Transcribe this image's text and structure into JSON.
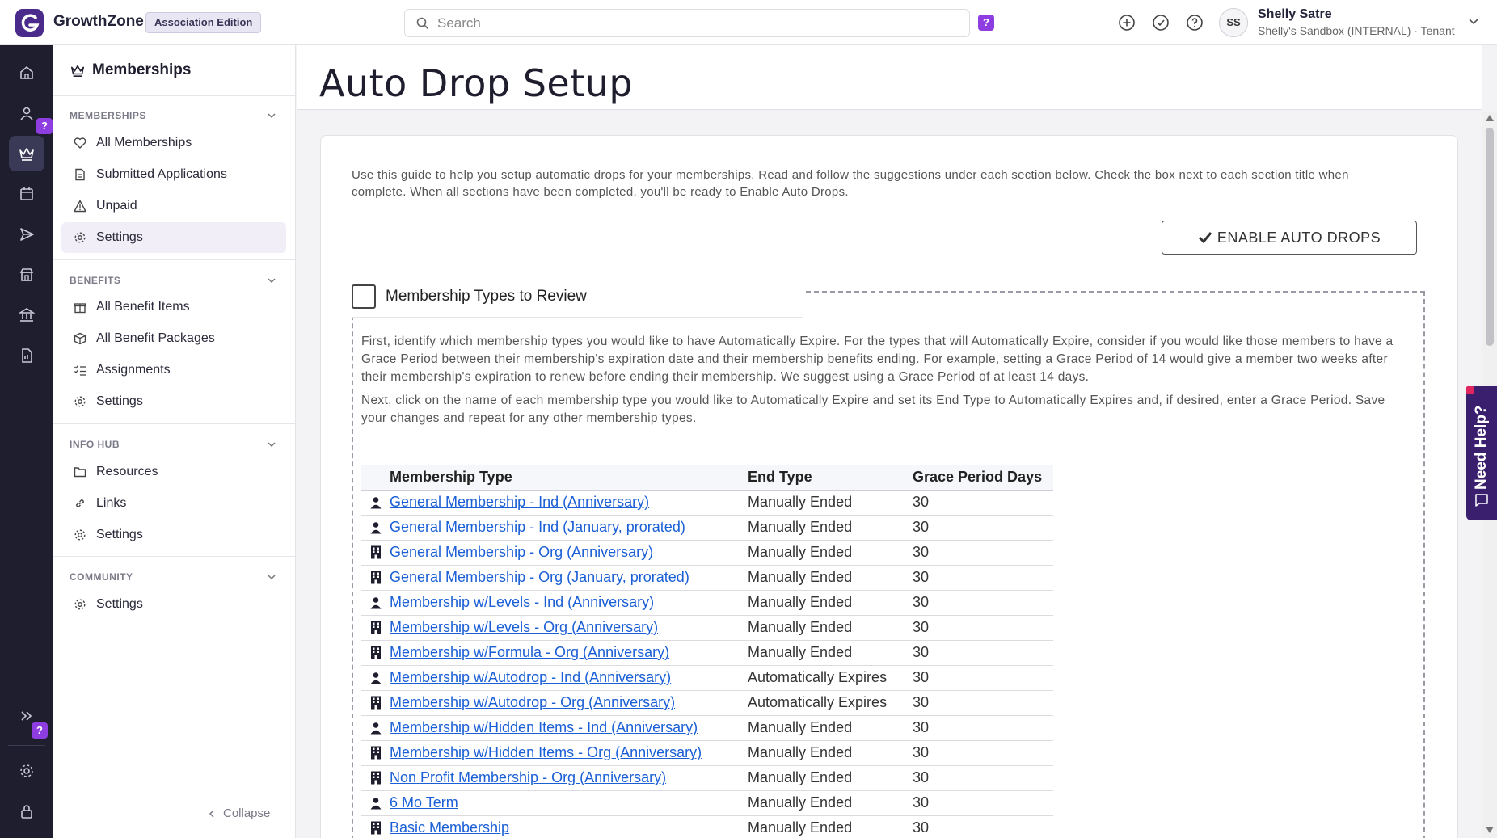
{
  "app": {
    "name": "GrowthZone",
    "edition": "Association Edition"
  },
  "search": {
    "placeholder": "Search"
  },
  "user": {
    "initials": "SS",
    "name": "Shelly Satre",
    "org": "Shelly's Sandbox (INTERNAL) · Tenant"
  },
  "sidebar": {
    "title": "Memberships",
    "sections": [
      {
        "label": "MEMBERSHIPS",
        "items": [
          {
            "label": "All Memberships",
            "icon": "heart-icon"
          },
          {
            "label": "Submitted Applications",
            "icon": "document-icon"
          },
          {
            "label": "Unpaid",
            "icon": "warning-icon"
          },
          {
            "label": "Settings",
            "icon": "gear-icon",
            "active": true
          }
        ]
      },
      {
        "label": "BENEFITS",
        "items": [
          {
            "label": "All Benefit Items",
            "icon": "gift-icon"
          },
          {
            "label": "All Benefit Packages",
            "icon": "package-icon"
          },
          {
            "label": "Assignments",
            "icon": "checklist-icon"
          },
          {
            "label": "Settings",
            "icon": "gear-icon"
          }
        ]
      },
      {
        "label": "INFO HUB",
        "items": [
          {
            "label": "Resources",
            "icon": "folder-icon"
          },
          {
            "label": "Links",
            "icon": "link-icon"
          },
          {
            "label": "Settings",
            "icon": "gear-icon"
          }
        ]
      },
      {
        "label": "COMMUNITY",
        "items": [
          {
            "label": "Settings",
            "icon": "gear-icon"
          }
        ]
      }
    ],
    "collapse_label": "Collapse"
  },
  "page": {
    "title": "Auto Drop Setup",
    "intro": "Use this guide to help you setup automatic drops for your memberships. Read and follow the suggestions under each section below. Check the box next to each section title when complete. When all sections have been completed, you'll be ready to Enable Auto Drops.",
    "enable_button": "ENABLE AUTO DROPS",
    "section": {
      "title": "Membership Types to Review",
      "para1": "First, identify which membership types you would like to have Automatically Expire. For the types that will Automatically Expire, consider if you would like those members to have a Grace Period between their membership's expiration date and their membership benefits ending. For example, setting a Grace Period of 14 would give a member two weeks after their membership's expiration to renew before ending their membership. We suggest using a Grace Period of at least 14 days.",
      "para2": "Next, click on the name of each membership type you would like to Automatically Expire and set its End Type to Automatically Expires and, if desired, enter a Grace Period. Save your changes and repeat for any other membership types."
    },
    "table": {
      "headers": {
        "type": "Membership Type",
        "end": "End Type",
        "grace": "Grace Period Days"
      },
      "rows": [
        {
          "kind": "person",
          "type": "General Membership - Ind (Anniversary)",
          "end": "Manually Ended",
          "grace": "30"
        },
        {
          "kind": "person",
          "type": "General Membership - Ind (January, prorated)",
          "end": "Manually Ended",
          "grace": "30"
        },
        {
          "kind": "building",
          "type": "General Membership - Org (Anniversary)",
          "end": "Manually Ended",
          "grace": "30"
        },
        {
          "kind": "building",
          "type": "General Membership - Org (January, prorated)",
          "end": "Manually Ended",
          "grace": "30"
        },
        {
          "kind": "person",
          "type": "Membership w/Levels - Ind (Anniversary)",
          "end": "Manually Ended",
          "grace": "30"
        },
        {
          "kind": "building",
          "type": "Membership w/Levels - Org (Anniversary)",
          "end": "Manually Ended",
          "grace": "30"
        },
        {
          "kind": "building",
          "type": "Membership w/Formula - Org (Anniversary)",
          "end": "Manually Ended",
          "grace": "30"
        },
        {
          "kind": "person",
          "type": "Membership w/Autodrop - Ind (Anniversary)",
          "end": "Automatically Expires",
          "grace": "30"
        },
        {
          "kind": "building",
          "type": "Membership w/Autodrop - Org (Anniversary)",
          "end": "Automatically Expires",
          "grace": "30"
        },
        {
          "kind": "person",
          "type": "Membership w/Hidden Items - Ind (Anniversary)",
          "end": "Manually Ended",
          "grace": "30"
        },
        {
          "kind": "building",
          "type": "Membership w/Hidden Items - Org (Anniversary)",
          "end": "Manually Ended",
          "grace": "30"
        },
        {
          "kind": "building",
          "type": "Non Profit Membership - Org (Anniversary)",
          "end": "Manually Ended",
          "grace": "30"
        },
        {
          "kind": "person",
          "type": "6 Mo Term",
          "end": "Manually Ended",
          "grace": "30"
        },
        {
          "kind": "building",
          "type": "Basic Membership",
          "end": "Manually Ended",
          "grace": "30"
        }
      ]
    }
  },
  "help_tab": {
    "label": "Need Help?"
  },
  "badge": {
    "question": "?"
  },
  "colors": {
    "brand": "#4a2a8a",
    "rail": "#1e1e2f",
    "link": "#1a5fd6",
    "badge": "#8e3ee0"
  }
}
